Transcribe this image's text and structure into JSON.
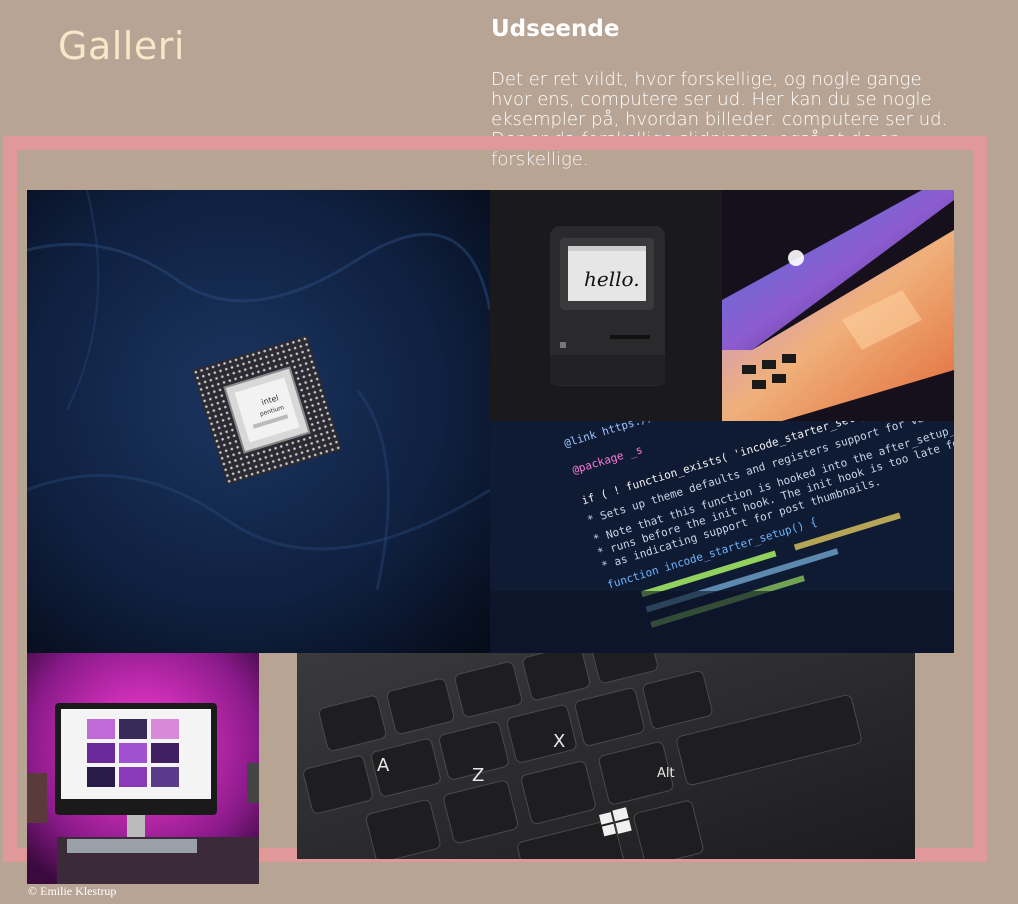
{
  "page": {
    "title": "Galleri"
  },
  "section": {
    "title": "Udseende",
    "body": "Det er ret vildt, hvor forskellige, og nogle gange hvor ens, computere ser ud. Her kan du se nogle eksempler på, hvordan billeder. computere ser ud. Der er da forskellige slidninger, også at de er forskellige."
  },
  "gallery": {
    "images": [
      {
        "subject": "intel pentium processor on dark fabric",
        "chip_brand": "intel",
        "chip_name": "pentium"
      },
      {
        "subject": "retro Macintosh computer showing hello",
        "screen_text": "hello."
      },
      {
        "subject": "MacBook laptop with colorful glow"
      },
      {
        "subject": "code editor screen",
        "code_lines": [
          "@link https://deve",
          "@package _s",
          "if ( ! function_exists( 'incode_starter_setup' ) ) :",
          "* Sets up theme defaults and registers support for various WordPress features.",
          "* Note that this function is hooked into the after_setup_theme hook, which",
          "* runs before the init hook. The init hook is too late for some features, such",
          "* as indicating support for post thumbnails.",
          "function incode_starter_setup() {"
        ]
      },
      {
        "subject": "iMac on desk with pink light"
      },
      {
        "subject": "laptop keyboard close-up with Windows key",
        "keys": [
          "A",
          "Z",
          "X",
          "Alt"
        ]
      }
    ]
  },
  "footer": {
    "copyright": "© Emilie Klestrup"
  },
  "colors": {
    "background": "#b8a494",
    "frame": "#e09998",
    "title": "#f6e8c8"
  }
}
